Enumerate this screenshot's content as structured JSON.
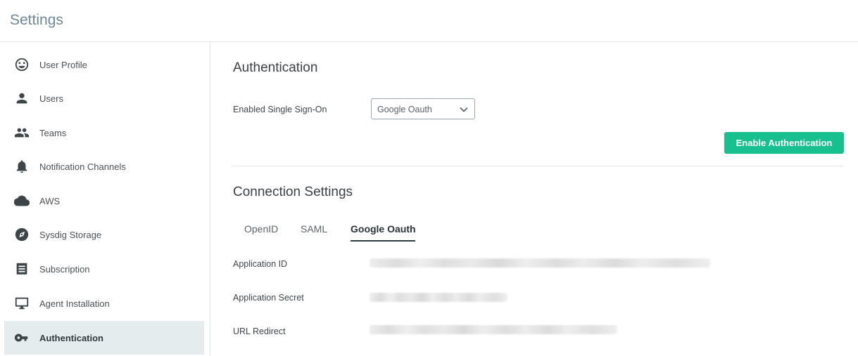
{
  "header": {
    "title": "Settings"
  },
  "sidebar": {
    "items": [
      {
        "label": "User Profile",
        "icon": "smiley-icon"
      },
      {
        "label": "Users",
        "icon": "person-icon"
      },
      {
        "label": "Teams",
        "icon": "group-icon"
      },
      {
        "label": "Notification Channels",
        "icon": "bell-icon"
      },
      {
        "label": "AWS",
        "icon": "cloud-icon"
      },
      {
        "label": "Sysdig Storage",
        "icon": "storage-icon"
      },
      {
        "label": "Subscription",
        "icon": "receipt-icon"
      },
      {
        "label": "Agent Installation",
        "icon": "monitor-icon"
      },
      {
        "label": "Authentication",
        "icon": "key-icon",
        "active": true
      }
    ]
  },
  "main": {
    "title": "Authentication",
    "sso_label": "Enabled Single Sign-On",
    "sso_select": {
      "value": "Google Oauth"
    },
    "enable_button": "Enable Authentication",
    "connection_title": "Connection Settings",
    "tabs": [
      {
        "label": "OpenID"
      },
      {
        "label": "SAML"
      },
      {
        "label": "Google Oauth",
        "active": true
      }
    ],
    "fields": [
      {
        "label": "Application ID",
        "value_redacted": true
      },
      {
        "label": "Application Secret",
        "value_redacted": true
      },
      {
        "label": "URL Redirect",
        "value_redacted": true
      }
    ]
  },
  "colors": {
    "accent": "#17c08e",
    "active_nav_bg": "#e5eced",
    "title": "#6f8796"
  }
}
